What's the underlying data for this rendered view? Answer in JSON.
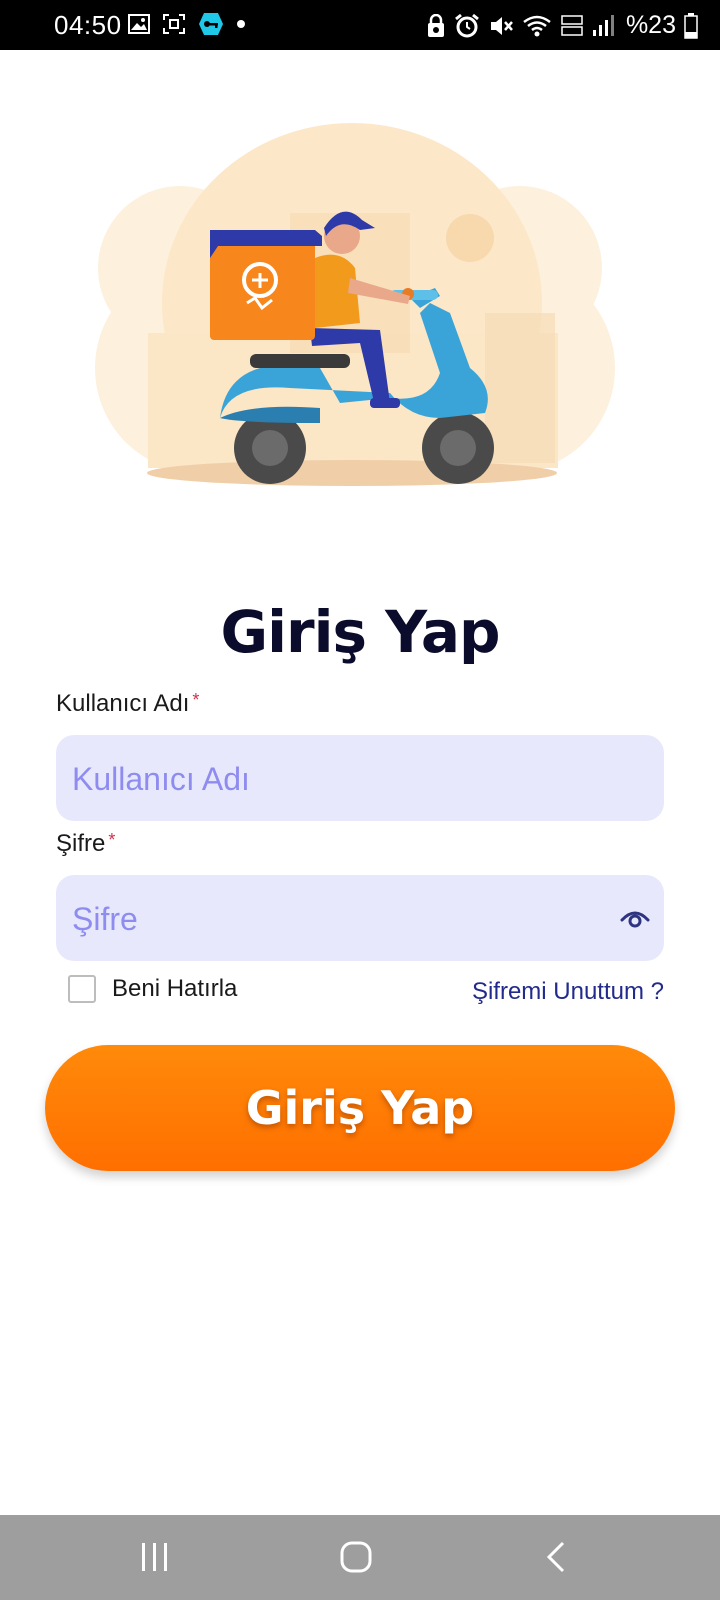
{
  "status_bar": {
    "time": "04:50",
    "battery": "%23",
    "left_icons": [
      "gallery-icon",
      "screenshot-icon",
      "vpn-key-icon",
      "dot-icon"
    ],
    "right_icons": [
      "nfc-lock-icon",
      "alarm-icon",
      "mute-icon",
      "wifi-icon",
      "volte-icon",
      "signal-icon",
      "battery-icon"
    ]
  },
  "illustration": {
    "name": "delivery-scooter-illustration"
  },
  "login": {
    "title": "Giriş Yap",
    "username_label": "Kullanıcı Adı",
    "username_placeholder": "Kullanıcı Adı",
    "password_label": "Şifre",
    "password_placeholder": "Şifre",
    "required_mark": "*",
    "remember_label": "Beni Hatırla",
    "remember_checked": false,
    "forgot_link": "Şifremi Unuttum ?",
    "submit_label": "Giriş Yap"
  },
  "colors": {
    "accent": "#ff7a00",
    "field_bg": "#e8e8fc",
    "placeholder": "#8f8cf0",
    "link": "#222a8c",
    "title": "#0b0b2c"
  },
  "nav_bar": {
    "items": [
      "recent-apps-icon",
      "home-icon",
      "back-icon"
    ]
  }
}
